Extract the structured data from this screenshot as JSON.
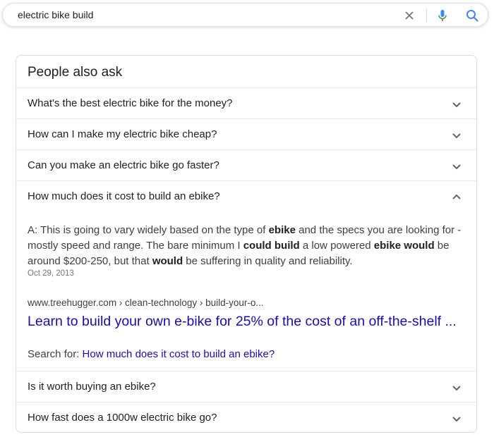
{
  "search": {
    "query": "electric bike build",
    "clear_icon": "close-icon",
    "mic_icon": "microphone-icon",
    "search_icon": "magnifier-icon"
  },
  "colors": {
    "link": "#1a0dab",
    "text": "#202124",
    "muted": "#70757a",
    "mic_blue": "#4285f4",
    "mic_red": "#ea4335"
  },
  "paa": {
    "title": "People also ask",
    "questions": [
      "What's the best electric bike for the money?",
      "How can I make my electric bike cheap?",
      "Can you make an electric bike go faster?",
      "How much does it cost to build an ebike?",
      "Is it worth buying an ebike?",
      "How fast does a 1000w electric bike go?"
    ],
    "expanded_index": 3,
    "answer": {
      "segments": [
        {
          "t": "A: This is going to vary widely based on the type of ",
          "b": false
        },
        {
          "t": "ebike",
          "b": true
        },
        {
          "t": " and the specs you are looking for - mostly speed and range. The bare minimum I ",
          "b": false
        },
        {
          "t": "could build",
          "b": true
        },
        {
          "t": " a low powered ",
          "b": false
        },
        {
          "t": "ebike would",
          "b": true
        },
        {
          "t": " be around $200-250, but that ",
          "b": false
        },
        {
          "t": "would",
          "b": true
        },
        {
          "t": " be suffering in quality and reliability.",
          "b": false
        }
      ],
      "date": "Oct 29, 2013",
      "cite": "www.treehugger.com › clean-technology › build-your-o...",
      "link_title": "Learn to build your own e-bike for 25% of the cost of an off-the-shelf ...",
      "search_for_label": "Search for:",
      "search_for_query": "How much does it cost to build an ebike?"
    }
  }
}
